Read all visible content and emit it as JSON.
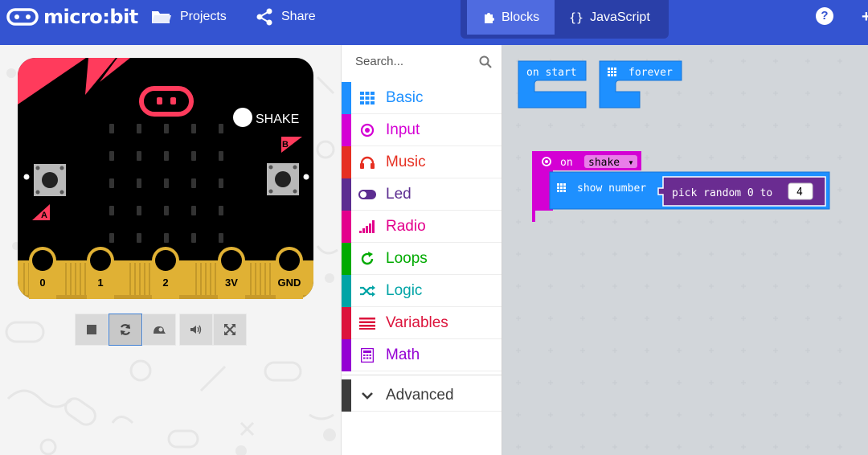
{
  "header": {
    "app_name": "micro:bit",
    "projects_label": "Projects",
    "share_label": "Share",
    "blocks_label": "Blocks",
    "javascript_label": "JavaScript",
    "help_label": "?",
    "colors": {
      "bar": "#3454D1",
      "mode_group": "#2A3FA8"
    }
  },
  "simulator": {
    "gesture_label": "SHAKE",
    "button_a": "A",
    "button_b": "B",
    "pins": [
      "0",
      "1",
      "2",
      "3V",
      "GND"
    ],
    "controls": [
      "stop-icon",
      "restart-icon",
      "slow-motion-icon",
      "mute-icon",
      "fullscreen-icon"
    ]
  },
  "toolbox": {
    "search_placeholder": "Search...",
    "categories": [
      {
        "label": "Basic",
        "color": "#1E90FF",
        "icon": "grid-icon"
      },
      {
        "label": "Input",
        "color": "#D400D4",
        "icon": "input-circle-icon"
      },
      {
        "label": "Music",
        "color": "#E63022",
        "icon": "headphones-icon"
      },
      {
        "label": "Led",
        "color": "#5C2D91",
        "icon": "toggle-icon"
      },
      {
        "label": "Radio",
        "color": "#E3008C",
        "icon": "signal-bars-icon"
      },
      {
        "label": "Loops",
        "color": "#00AA00",
        "icon": "refresh-icon"
      },
      {
        "label": "Logic",
        "color": "#00A4A6",
        "icon": "shuffle-icon"
      },
      {
        "label": "Variables",
        "color": "#DC143C",
        "icon": "list-icon"
      },
      {
        "label": "Math",
        "color": "#9400D3",
        "icon": "calculator-icon"
      }
    ],
    "advanced": {
      "label": "Advanced",
      "color": "#3C3C3C",
      "icon": "chevron-down-icon"
    }
  },
  "workspace": {
    "on_start": "on start",
    "forever": "forever",
    "on_event": "on",
    "event_value": "shake",
    "show_number": "show number",
    "pick_random": "pick random 0 to",
    "random_max": "4",
    "colors": {
      "basic": "#1E90FF",
      "input": "#D400D4",
      "math": "#9400D3"
    }
  }
}
